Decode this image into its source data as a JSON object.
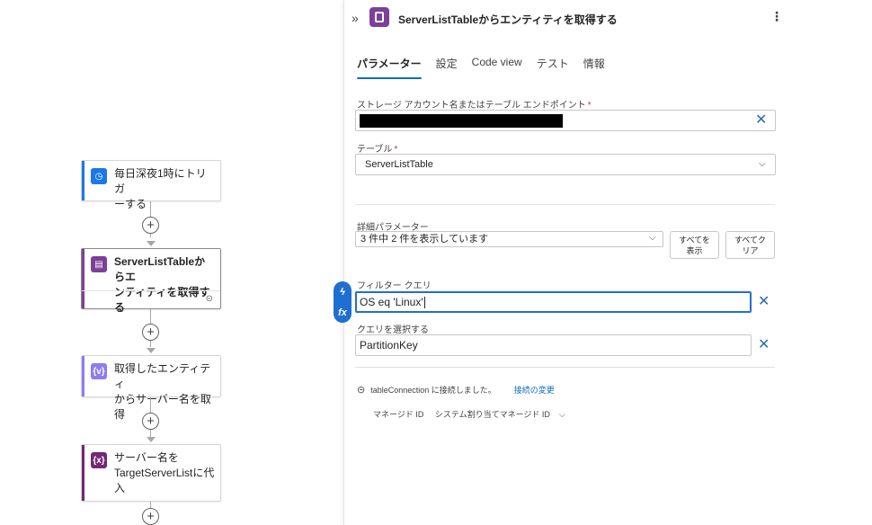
{
  "canvas": {
    "nodes": [
      {
        "title": "毎日深夜1時にトリガーする",
        "line1": "毎日深夜1時にトリガ",
        "line2": "ーする",
        "icon": "alarm-clock-icon",
        "color": "#1b78e5"
      },
      {
        "title": "ServerListTableからエンティティを取得する",
        "line1": "ServerListTableからエ",
        "line2": "ンティティを取得する",
        "icon": "table-storage-icon",
        "color": "#7d3f98"
      },
      {
        "title": "取得したエンティティからサーバー名を取得",
        "line1": "取得したエンティティ",
        "line2": "からサーバー名を取得",
        "icon": "variable-braces-icon",
        "color": "#8e7cf3"
      },
      {
        "title": "サーバー名をTargetServerListに代入",
        "line1": "サーバー名を",
        "line2": "TargetServerListに代",
        "line3": "入",
        "icon": "variable-x-icon",
        "color": "#742774"
      }
    ]
  },
  "panel": {
    "title": "ServerListTableからエンティティを取得する",
    "tabs": [
      "パラメーター",
      "設定",
      "Code view",
      "テスト",
      "情報"
    ],
    "fields": {
      "storage": {
        "label": "ストレージ アカウント名またはテーブル エンドポイント",
        "required": "*"
      },
      "table": {
        "label": "テーブル",
        "required": "*",
        "value": "ServerListTable"
      },
      "advanced": {
        "label": "詳細パラメーター",
        "value": "3 件中 2 件を表示しています",
        "show_all": [
          "すべてを",
          "表示"
        ],
        "clear_all": [
          "すべてク",
          "リア"
        ]
      },
      "filter": {
        "label": "フィルター クエリ",
        "value": "OS eq 'Linux'"
      },
      "select": {
        "label": "クエリを選択する",
        "value": "PartitionKey"
      }
    },
    "connection": {
      "text": "tableConnection に接続しました。",
      "change": "接続の変更"
    },
    "identity": {
      "label": "マネージド ID",
      "value": "システム割り当てマネージド ID"
    }
  },
  "colors": {
    "accent": "#0f6cbd",
    "table_icon": "#7d3f98",
    "dynamic_rail": "#1f6fd1"
  }
}
